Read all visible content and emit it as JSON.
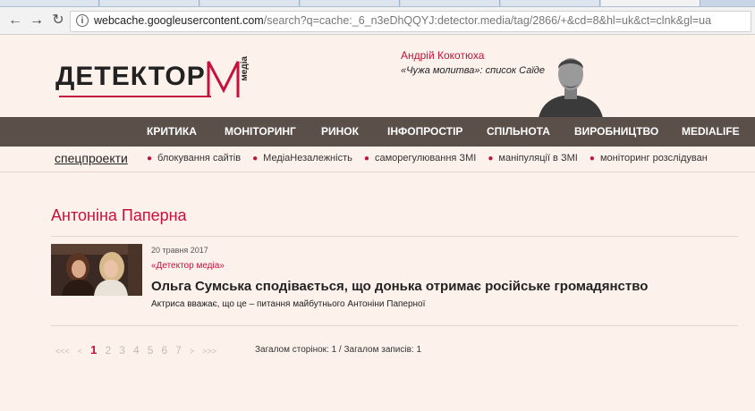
{
  "browser": {
    "url_host": "webcache.googleusercontent.com",
    "url_path": "/search?q=cache:_6_n3eDhQQYJ:detector.media/tag/2866/+&cd=8&hl=uk&ct=clnk&gl=ua"
  },
  "header": {
    "logo_text": "ДЕТЕКТОР",
    "logo_media": "медіа",
    "featured_author": "Андрій Кокотюха",
    "featured_title": "«Чужа молитва»: список Саїде"
  },
  "menu": [
    "КРИТИКА",
    "МОНІТОРИНГ",
    "РИНОК",
    "ІНФОПРОСТІР",
    "СПІЛЬНОТА",
    "ВИРОБНИЦТВО",
    "MEDIALIFE"
  ],
  "special_projects": {
    "title": "спецпроекти",
    "items": [
      "блокування сайтів",
      "МедіаНезалежність",
      "саморегулювання ЗМІ",
      "маніпуляції в ЗМІ",
      "моніторинг розслідуван"
    ]
  },
  "page": {
    "title": "Антоніна Паперна"
  },
  "articles": [
    {
      "date": "20 травня 2017",
      "source": "«Детектор медіа»",
      "title": "Ольга Сумська сподівається, що донька отримає російське громадянство",
      "lead": "Актриса вважає, що це – питання майбутнього Антоніни Паперної"
    }
  ],
  "pager": {
    "first": "<<<",
    "prev": "<",
    "pages": [
      "1",
      "2",
      "3",
      "4",
      "5",
      "6",
      "7"
    ],
    "current": "1",
    "next": ">",
    "last": ">>>",
    "total_text": "Загалом сторінок: 1 / Загалом записів: 1"
  },
  "colors": {
    "accent": "#c4123a",
    "menubar": "#5b4f4a",
    "background": "#fdf1ec"
  }
}
